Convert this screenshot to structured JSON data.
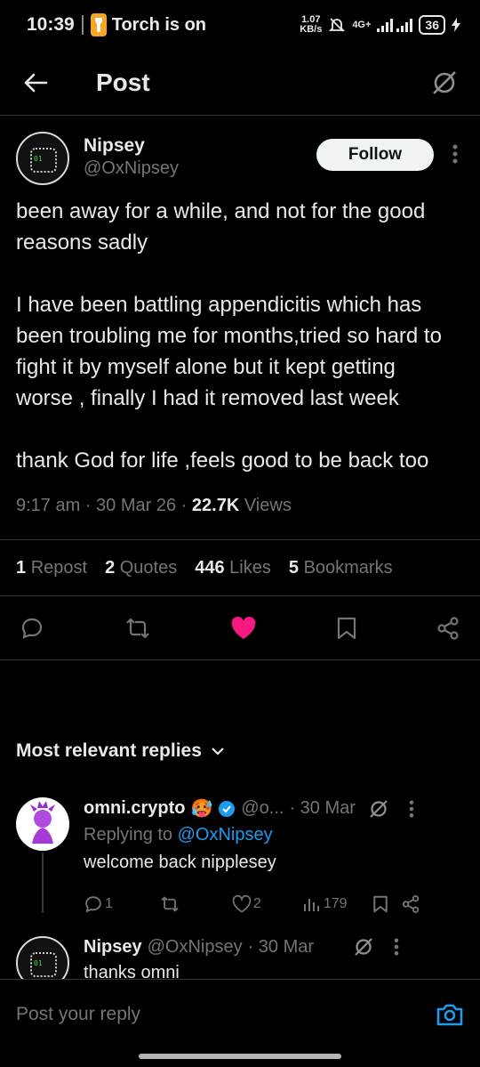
{
  "status_bar": {
    "time": "10:39",
    "notification": "Torch is on",
    "speed_value": "1.07",
    "speed_unit": "KB/s",
    "network": "4G+",
    "battery": "36"
  },
  "header": {
    "title": "Post"
  },
  "post": {
    "display_name": "Nipsey",
    "handle": "@OxNipsey",
    "follow_label": "Follow",
    "text": "been away for a while, and not for the good reasons sadly\n\nI have been battling appendicitis which has been troubling me for months,tried so hard to fight it by myself alone but it kept getting  worse , finally I had it removed last week\n\nthank God for life ,feels good to be back too",
    "time": "9:17 am",
    "date": "30 Mar 26",
    "views_count": "22.7K",
    "views_label": "Views",
    "stats": {
      "reposts_count": "1",
      "reposts_label": "Repost",
      "quotes_count": "2",
      "quotes_label": "Quotes",
      "likes_count": "446",
      "likes_label": "Likes",
      "bookmarks_count": "5",
      "bookmarks_label": "Bookmarks"
    }
  },
  "replies": {
    "heading": "Most relevant replies",
    "items": [
      {
        "display_name": "omni.crypto",
        "emoji": "🥵",
        "handle": "@o...",
        "date": "· 30 Mar",
        "replying_prefix": "Replying to",
        "replying_to": "@OxNipsey",
        "text": "welcome back nipplesey",
        "replies": "1",
        "likes": "2",
        "views": "179"
      },
      {
        "display_name": "Nipsey",
        "handle": "@OxNipsey",
        "date": "· 30 Mar",
        "text": "thanks omni"
      }
    ]
  },
  "compose": {
    "placeholder": "Post your reply"
  },
  "colors": {
    "accent": "#1d9bf0",
    "like": "#f91880",
    "background": "#000000",
    "muted": "#71767b"
  }
}
